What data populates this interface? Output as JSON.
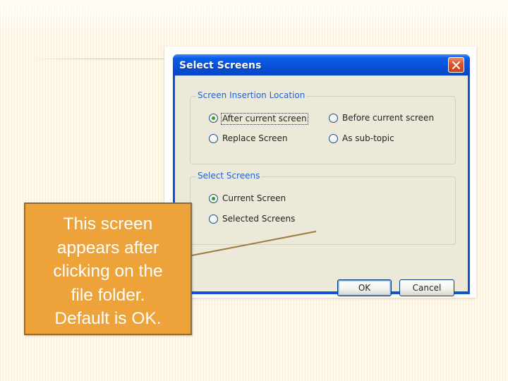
{
  "dialog": {
    "title": "Select Screens",
    "insertion_group": {
      "label": "Screen Insertion Location",
      "options": [
        {
          "label": "After current screen",
          "selected": true,
          "focused": true
        },
        {
          "label": "Before current screen",
          "selected": false,
          "focused": false
        },
        {
          "label": "Replace Screen",
          "selected": false,
          "focused": false
        },
        {
          "label": "As sub-topic",
          "selected": false,
          "focused": false
        }
      ]
    },
    "screens_group": {
      "label": "Select Screens",
      "options": [
        {
          "label": "Current Screen",
          "selected": true
        },
        {
          "label": "Selected Screens",
          "selected": false
        }
      ]
    },
    "ok_label": "OK",
    "cancel_label": "Cancel"
  },
  "callout": {
    "lines": [
      "This screen",
      "appears after",
      "clicking on the",
      "file folder.",
      "Default is OK."
    ]
  },
  "colors": {
    "titlebar": "#0a5ee6",
    "dialog_face": "#ece9d8",
    "group_label": "#2561d3",
    "callout_fill": "#eda23a",
    "callout_border": "#8e6a36",
    "pointer_line": "#9b7a43"
  },
  "icons": {
    "close": "close-icon"
  }
}
